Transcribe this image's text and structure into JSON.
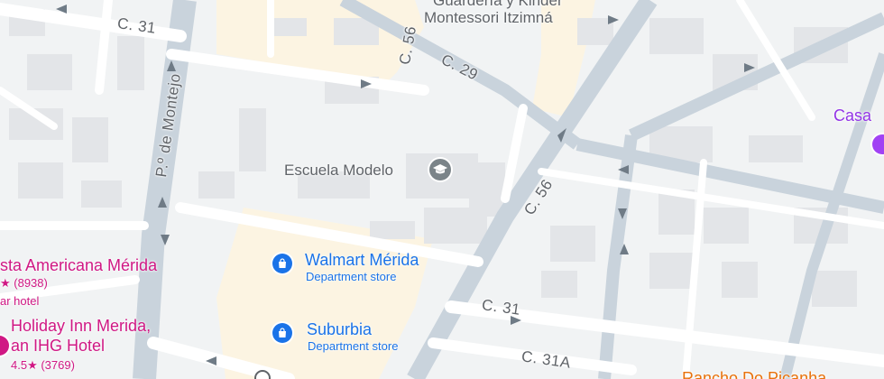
{
  "map": {
    "colors": {
      "background": "#f1f3f4",
      "road": "#ffffff",
      "major_road": "#c9d3dc",
      "block": "#e8eaed",
      "building": "#dfe1e5",
      "campus": "#fcf4e2",
      "pin_blue": "#1a73e8",
      "hotel_pink": "#d01884",
      "food_orange": "#e8710a",
      "school_gray": "#7b8489",
      "purple": "#a142f4"
    },
    "streets": {
      "c31_top": "C. 31",
      "c56_top": "C. 56",
      "c29": "C. 29",
      "paseo_montejo": "P.º de Montejo",
      "c56_mid": "C. 56",
      "c31_bottom": "C. 31",
      "c31a": "C. 31A"
    },
    "places": {
      "kinder_line1": "Guardería y Kinder",
      "kinder_line2": "Montessori Itzimná",
      "escuela": "Escuela Modelo",
      "casa": "Casa",
      "rancho": "Rancho Do Picanha"
    },
    "stores": [
      {
        "name": "Walmart Mérida",
        "category": "Department store",
        "icon": "shopping-bag-icon"
      },
      {
        "name": "Suburbia",
        "category": "Department store",
        "icon": "shopping-bag-icon"
      }
    ],
    "hotels": [
      {
        "name_line1": "sta Americana Mérida",
        "rating_text": "★ (8938)",
        "type": "ar hotel"
      },
      {
        "name_line1": "Holiday Inn Merida,",
        "name_line2": "an IHG Hotel",
        "rating_text": "4.5★ (3769)"
      }
    ]
  }
}
